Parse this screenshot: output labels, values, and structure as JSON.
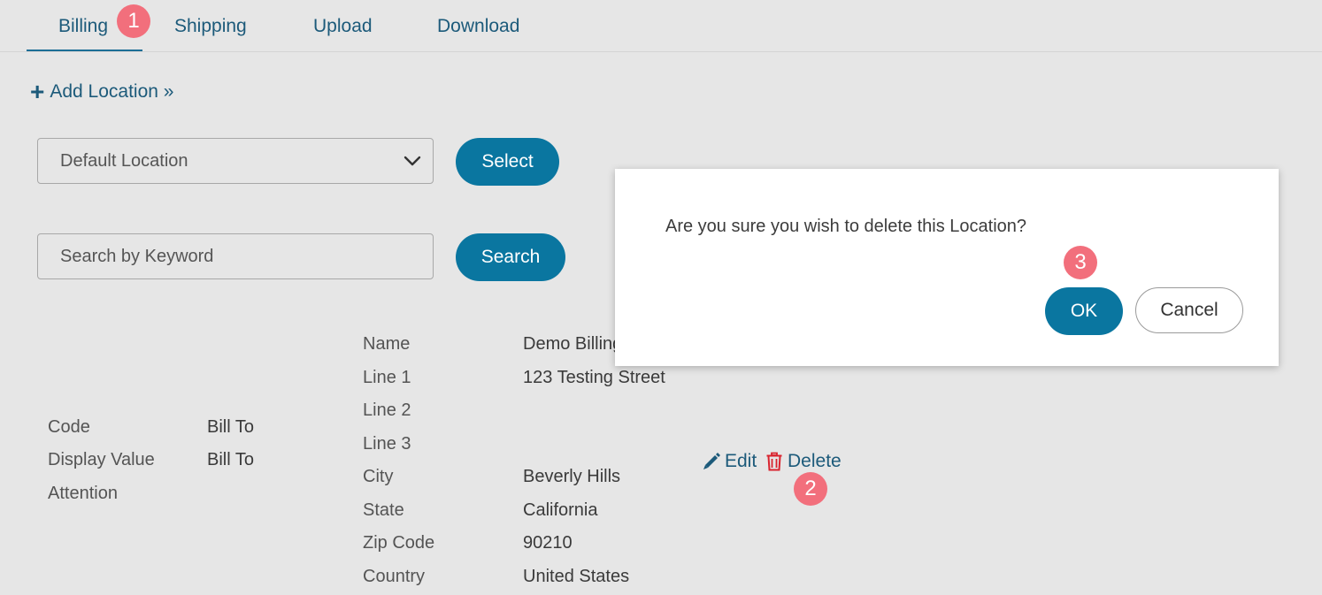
{
  "tabs": [
    {
      "label": "Billing"
    },
    {
      "label": "Shipping"
    },
    {
      "label": "Upload"
    },
    {
      "label": "Download"
    }
  ],
  "annotations": {
    "step1": "1",
    "step2": "2",
    "step3": "3"
  },
  "add_location": {
    "label": "Add Location »"
  },
  "location_select": {
    "value": "Default Location"
  },
  "select_button": {
    "label": "Select"
  },
  "search": {
    "placeholder": "Search by Keyword"
  },
  "search_button": {
    "label": "Search"
  },
  "location_record": {
    "code_label": "Code",
    "code_value": "Bill To",
    "display_label": "Display Value",
    "display_value": "Bill To",
    "attention_label": "Attention",
    "address": [
      {
        "label": "Name",
        "value": "Demo Billing"
      },
      {
        "label": "Line 1",
        "value": "123 Testing Street"
      },
      {
        "label": "Line 2",
        "value": ""
      },
      {
        "label": "Line 3",
        "value": ""
      },
      {
        "label": "City",
        "value": "Beverly Hills"
      },
      {
        "label": "State",
        "value": "California"
      },
      {
        "label": "Zip Code",
        "value": "90210"
      },
      {
        "label": "Country",
        "value": "United States"
      }
    ],
    "edit_label": "Edit",
    "delete_label": "Delete"
  },
  "dialog": {
    "message": "Are you sure you wish to delete this Location?",
    "ok_label": "OK",
    "cancel_label": "Cancel"
  },
  "colors": {
    "accent": "#0a76a0",
    "link": "#1c5a7a",
    "badge": "#f26f7c",
    "delete_icon": "#d9232e"
  }
}
